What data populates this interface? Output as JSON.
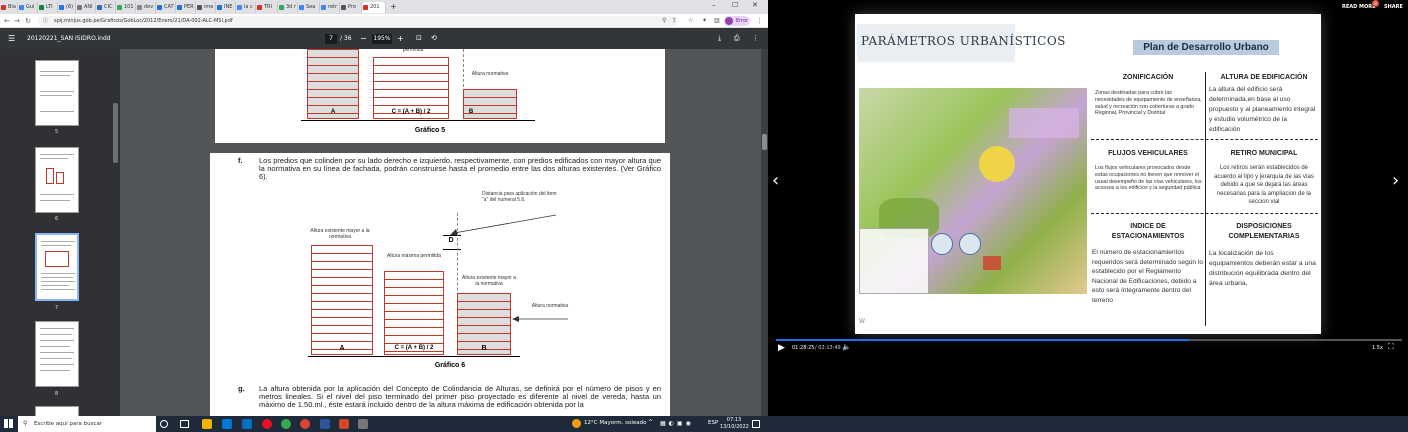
{
  "browser": {
    "tabs": [
      "Bla",
      "Guí",
      "LTI",
      "(6)",
      "ANI",
      "CIC",
      "101",
      "dev",
      "CAT",
      "PER",
      "ime",
      "INE",
      "la c",
      "TRI",
      "3d r",
      "Sea",
      "retr",
      "Pro",
      "201"
    ],
    "url": "spij.minjus.gob.pe/Graficos/GobLoc/2012/Enero/21/DA-002-ALC-MSI.pdf",
    "profile": "Error"
  },
  "pdf": {
    "filename": "20120221_SAN ISIDRO.indd",
    "page_current": "7",
    "page_total": "/ 36",
    "zoom": "195%",
    "thumb_numbers": [
      "5",
      "6",
      "7",
      "8"
    ],
    "top_labels": {
      "permitida": "permitida",
      "altura_normativa": "Altura normativa",
      "a": "A",
      "c": "C = (A + B) / 2",
      "b": "B",
      "caption": "Gráfico 5"
    },
    "para_f_letter": "f.",
    "para_f": "Los predios que colinden por su lado derecho e izquierdo, respectivamente, con predios edificados con mayor altura que la normativa en su línea de fachada, podrán construirse hasta el promedio entre las dos alturas existentes. (Ver Gráfico 6).",
    "g6": {
      "distancia": "Distancia para aplicación del item \"a\" del numeral 5.6.",
      "alt_exist_left": "Altura existente mayor a la normativa",
      "alt_max": "Altura máxima permitida",
      "d": "D",
      "alt_exist_right": "Altura existente mayor a la normativa",
      "alt_norm": "Altura normativa",
      "a": "A",
      "c": "C = (A + B) / 2",
      "b": "B",
      "caption": "Gráfico 6"
    },
    "para_g_letter": "g.",
    "para_g": "La altura obtenida por la aplicación del Concepto de Colindancia de Alturas, se definirá por el número de pisos y en metros lineales. Si el nivel del piso terminado del primer piso proyectado es diferente al nivel de vereda, hasta un máximo de 1.50.ml., éste estará incluido dentro de la altura máxima de edificación obtenida por la"
  },
  "taskbar": {
    "search": "Escribe aquí para buscar",
    "weather": "12°C  Mayorm. soleado",
    "lang": "ESP",
    "time": "07:13",
    "date": "13/10/2022"
  },
  "video": {
    "read_more": "READ MORE",
    "read_more_badge": "8",
    "share": "SHARE",
    "time_current": "01:28:25",
    "time_total": "/ 02:13:49",
    "speed": "1.5x",
    "progress": 0.66,
    "slide": {
      "title": "PARÁMETROS URBANÍSTICOS",
      "plan_title": "Plan de Desarrollo Urbano",
      "watermark": "W",
      "zon_head": "ZONIFICACIÓN",
      "zon_body": "Zonas destinadas para cubrir las necesidades de equipamiento de enseñanza, salud y recreación con coberturas a grado Regional, Provincial y Distrital",
      "alt_head": "ALTURA DE EDIFICACIÓN",
      "alt_body": "La altura del edificio será determinada,en base al uso propuesto y al planeamiento integral y estudio volumétrico de la edificación",
      "flu_head": "FLUJOS VEHICULARES",
      "flu_body": "Los flujos vehiculares provocados desde estas ocupaciones no tienen que remover el usual desempeño de las vías vehiculares, los accesos a los edificios y la seguridad  pública",
      "ret_head": "RETIRO MUNICIPAL",
      "ret_body": "Los retiros serán establecidos de acuerdo al tipo y jerarquía de las vías  debido a que se dejará las áreas necesarias para la ampliacion de la seccion vial",
      "est_head": "INDICE DE ESTACIONAMIENTOS",
      "est_body": "El número de estacionamientos requeridos será determinado según lo establecido por el Reglamento Nacional de Edificaciones, debido a esto será íntegramente  dentro del terreno",
      "dis_head": "DISPOSICIONES COMPLEMENTARIAS",
      "dis_body": "La localización de los equipamientos deberán estar a una distribución equilibrada  dentro del área urbana,"
    }
  },
  "colors": {
    "accent": "#1a73e8",
    "plan_title_bg": "#b8cbe0",
    "map_green": "#9bc45a",
    "bar_red": "#c0392b"
  }
}
